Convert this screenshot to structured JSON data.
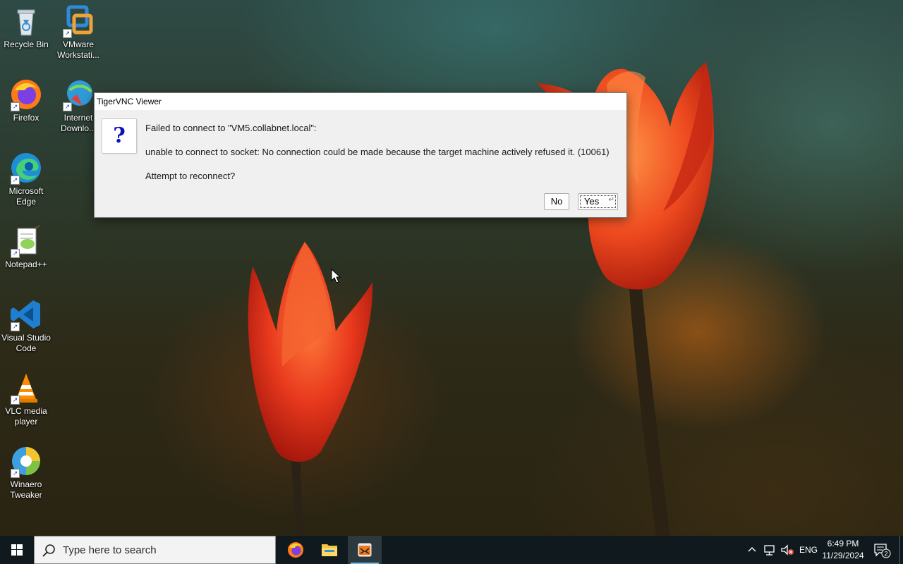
{
  "desktop": {
    "icons": [
      {
        "label": "Recycle Bin",
        "icon": "recycle-bin-icon"
      },
      {
        "label": "VMware Workstati...",
        "icon": "vmware-icon"
      },
      {
        "label": "Firefox",
        "icon": "firefox-icon"
      },
      {
        "label": "Internet Downlo...",
        "icon": "internet-download-manager-icon"
      },
      {
        "label": "Microsoft Edge",
        "icon": "edge-icon"
      },
      {
        "label": "Notepad++",
        "icon": "notepadpp-icon"
      },
      {
        "label": "Visual Studio Code",
        "icon": "vscode-icon"
      },
      {
        "label": "VLC media player",
        "icon": "vlc-icon"
      },
      {
        "label": "Winaero Tweaker",
        "icon": "winaero-tweaker-icon"
      }
    ]
  },
  "dialog": {
    "title": "TigerVNC Viewer",
    "icon": "question-icon",
    "line1": "Failed to connect to \"VM5.collabnet.local\":",
    "line2": "unable to connect to socket: No connection could be made because the target machine actively refused it. (10061)",
    "line3": "Attempt to reconnect?",
    "no_label": "No",
    "yes_label": "Yes"
  },
  "taskbar": {
    "search_placeholder": "Type here to search",
    "apps": [
      {
        "name": "Firefox",
        "icon": "firefox-icon",
        "active": false
      },
      {
        "name": "File Explorer",
        "icon": "folder-icon",
        "active": false
      },
      {
        "name": "TigerVNC Viewer",
        "icon": "tigervnc-icon",
        "active": true
      }
    ],
    "tray": {
      "language": "ENG",
      "time": "6:49 PM",
      "date": "11/29/2024",
      "notification_count": "2"
    }
  },
  "colors": {
    "accent": "#76b9ed",
    "question_mark": "#0c12b5",
    "taskbar": "#101a1e"
  }
}
